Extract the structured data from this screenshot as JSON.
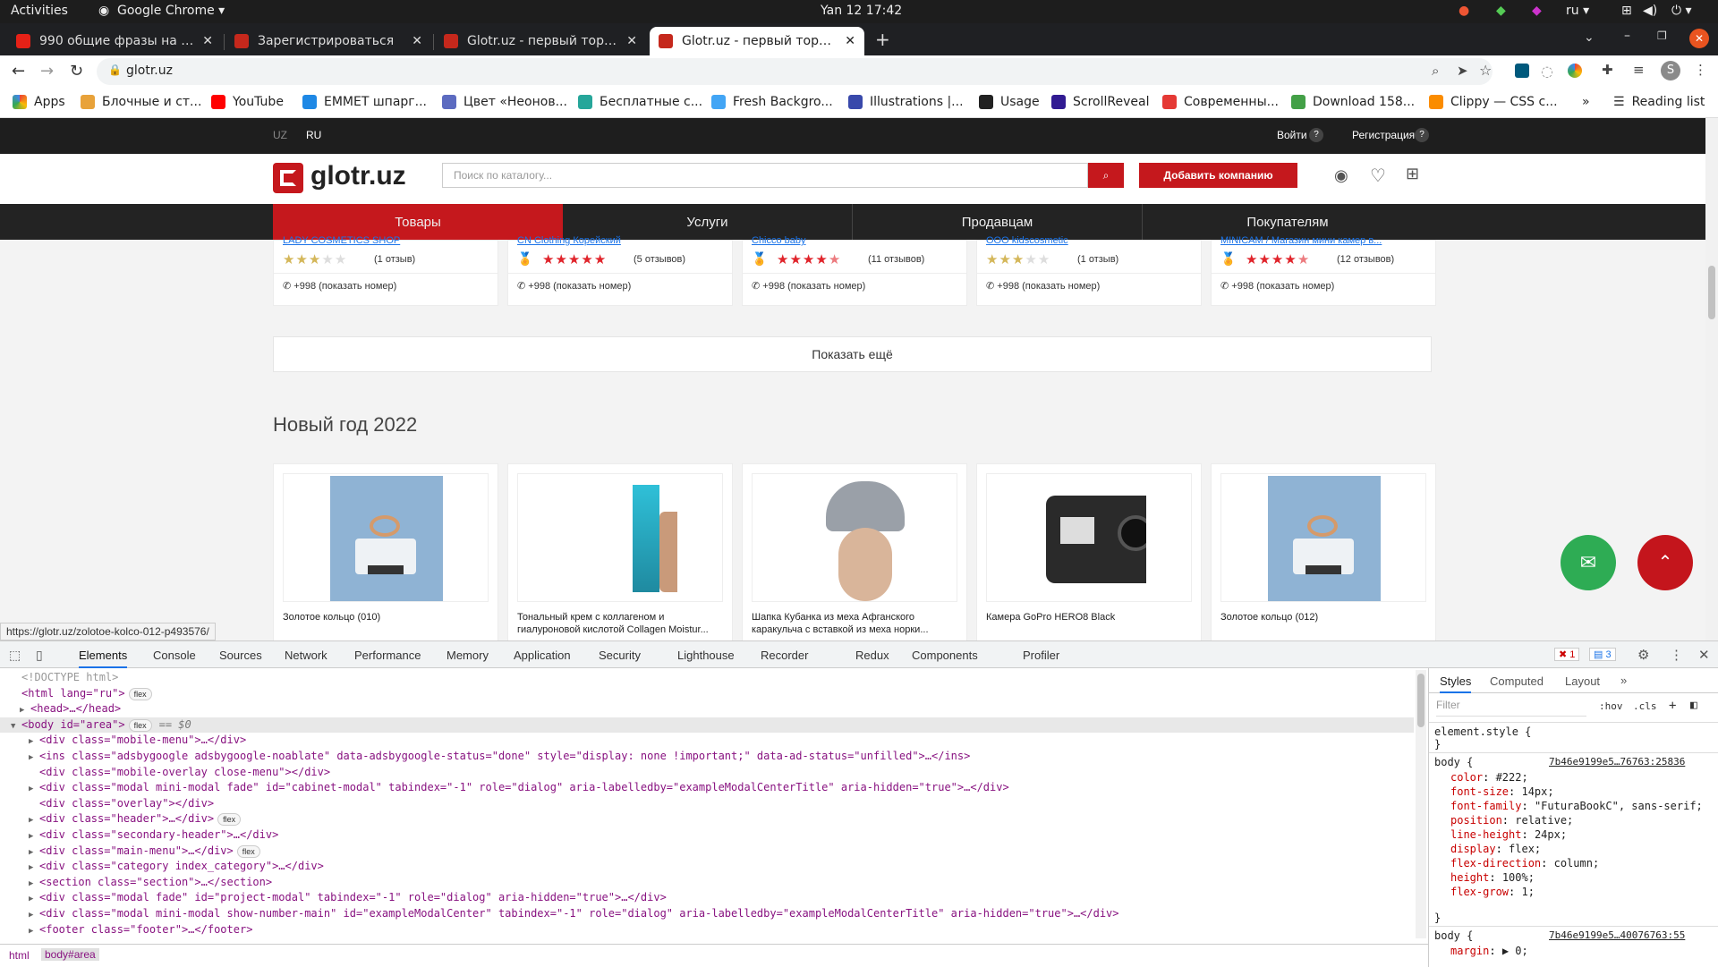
{
  "os": {
    "activities": "Activities",
    "app": "Google Chrome",
    "clock": "Yan 12  17:42",
    "lang": "ru"
  },
  "tabs": [
    {
      "label": "990 общие фразы на англ",
      "color": "#e62117"
    },
    {
      "label": "Зарегистрироваться",
      "color": "#c5281c"
    },
    {
      "label": "Glotr.uz - первый торговый",
      "color": "#c5281c"
    },
    {
      "label": "Glotr.uz - первый торговый",
      "color": "#c5281c"
    }
  ],
  "address": {
    "url": "glotr.uz"
  },
  "bookmarks": [
    {
      "label": "Apps",
      "color": "#ea4335"
    },
    {
      "label": "Блочные и ст...",
      "color": "#e8a23a"
    },
    {
      "label": "YouTube",
      "color": "#ff0000"
    },
    {
      "label": "EMMET шпарг...",
      "color": "#1e88e5"
    },
    {
      "label": "Цвет «Неонов...",
      "color": "#5c6bc0"
    },
    {
      "label": "Бесплатные с...",
      "color": "#26a69a"
    },
    {
      "label": "Fresh Backgro...",
      "color": "#42a5f5"
    },
    {
      "label": "Illustrations |...",
      "color": "#3949ab"
    },
    {
      "label": "Usage",
      "color": "#222222"
    },
    {
      "label": "ScrollReveal",
      "color": "#311b92"
    },
    {
      "label": "Современны...",
      "color": "#e53935"
    },
    {
      "label": "Download 158...",
      "color": "#43a047"
    },
    {
      "label": "Clippy — CSS c...",
      "color": "#fb8c00"
    }
  ],
  "reading_list": "Reading list",
  "site": {
    "lang_uz": "UZ",
    "lang_ru": "RU",
    "login": "Войти",
    "register": "Регистрация",
    "help": "?",
    "logo": "glotr.uz",
    "search_placeholder": "Поиск по каталогу...",
    "add_company": "Добавить компанию",
    "menu": [
      "Товары",
      "Услуги",
      "Продавцам",
      "Покупателям"
    ],
    "sellers": [
      {
        "name": "LADY COSMETICS SHOP",
        "rating": 3,
        "reviews": "(1 отзыв)",
        "phone": "+998 (показать номер)",
        "medal": false
      },
      {
        "name": "CN Clothing Корейский",
        "rating": 5,
        "reviews": "(5 отзывов)",
        "phone": "+998 (показать номер)",
        "medal": true
      },
      {
        "name": "Chicco baby",
        "rating": 4.5,
        "reviews": "(11 отзывов)",
        "phone": "+998 (показать номер)",
        "medal": true
      },
      {
        "name": "OOO kidscosmetic",
        "rating": 3,
        "reviews": "(1 отзыв)",
        "phone": "+998 (показать номер)",
        "medal": false
      },
      {
        "name": "MINICAM / Магазин мини камер в...",
        "rating": 4.5,
        "reviews": "(12 отзывов)",
        "phone": "+998 (показать номер)",
        "medal": true
      }
    ],
    "show_more": "Показать ещё",
    "section_title": "Новый год 2022",
    "products": [
      {
        "title": "Золотое кольцо (010)",
        "image": "ring"
      },
      {
        "title": "Тональный крем с коллагеном и гиалуроновой кислотой Collagen Moistur...",
        "image": "cream"
      },
      {
        "title": "Шапка Кубанка из меха Афганского каракульча с вставкой из меха норки...",
        "image": "hat"
      },
      {
        "title": "Камера GoPro HERO8 Black",
        "image": "camera"
      },
      {
        "title": "Золотое кольцо (012)",
        "image": "ring"
      }
    ],
    "status_url": "https://glotr.uz/zolotoe-kolco-012-p493576/"
  },
  "devtools": {
    "tabs": [
      "Elements",
      "Console",
      "Sources",
      "Network",
      "Performance",
      "Memory",
      "Application",
      "Security",
      "Lighthouse",
      "Recorder",
      "Redux",
      "Components",
      "Profiler"
    ],
    "errors": "1",
    "messages": "3",
    "dom": [
      {
        "indent": 0,
        "text": "<!DOCTYPE html>",
        "kind": "doctype"
      },
      {
        "indent": 0,
        "text": "<html lang=\"ru\">",
        "kind": "tag",
        "badge": "flex"
      },
      {
        "indent": 1,
        "text": "<head>…</head>",
        "kind": "tag",
        "arrow": true
      },
      {
        "indent": 0,
        "text": "<body id=\"area\">",
        "kind": "tag",
        "badge": "flex",
        "suffix": "== $0",
        "selected": true,
        "open": true
      },
      {
        "indent": 2,
        "text": "<div class=\"mobile-menu\">…</div>",
        "kind": "tag",
        "arrow": true
      },
      {
        "indent": 2,
        "text": "<ins class=\"adsbygoogle adsbygoogle-noablate\" data-adsbygoogle-status=\"done\" style=\"display: none !important;\" data-ad-status=\"unfilled\">…</ins>",
        "kind": "tag",
        "arrow": true
      },
      {
        "indent": 2,
        "text": "<div class=\"mobile-overlay close-menu\"></div>",
        "kind": "tag"
      },
      {
        "indent": 2,
        "text": "<div class=\"modal mini-modal fade\" id=\"cabinet-modal\" tabindex=\"-1\" role=\"dialog\" aria-labelledby=\"exampleModalCenterTitle\" aria-hidden=\"true\">…</div>",
        "kind": "tag",
        "arrow": true
      },
      {
        "indent": 2,
        "text": "<div class=\"overlay\"></div>",
        "kind": "tag"
      },
      {
        "indent": 2,
        "text": "<div class=\"header\">…</div>",
        "kind": "tag",
        "arrow": true,
        "badge": "flex"
      },
      {
        "indent": 2,
        "text": "<div class=\"secondary-header\">…</div>",
        "kind": "tag",
        "arrow": true
      },
      {
        "indent": 2,
        "text": "<div class=\"main-menu\">…</div>",
        "kind": "tag",
        "arrow": true,
        "badge": "flex"
      },
      {
        "indent": 2,
        "text": "<div class=\"category index_category\">…</div>",
        "kind": "tag",
        "arrow": true
      },
      {
        "indent": 2,
        "text": "<section class=\"section\">…</section>",
        "kind": "tag",
        "arrow": true
      },
      {
        "indent": 2,
        "text": "<div class=\"modal fade\" id=\"project-modal\" tabindex=\"-1\" role=\"dialog\" aria-hidden=\"true\">…</div>",
        "kind": "tag",
        "arrow": true
      },
      {
        "indent": 2,
        "text": "<div class=\"modal mini-modal show-number-main\" id=\"exampleModalCenter\" tabindex=\"-1\" role=\"dialog\" aria-labelledby=\"exampleModalCenterTitle\" aria-hidden=\"true\">…</div>",
        "kind": "tag",
        "arrow": true
      },
      {
        "indent": 2,
        "text": "<footer class=\"footer\">…</footer>",
        "kind": "tag",
        "arrow": true
      }
    ],
    "breadcrumb": [
      "html",
      "body#area"
    ],
    "styles": {
      "tabs": [
        "Styles",
        "Computed",
        "Layout"
      ],
      "filter": "Filter",
      "hov": ":hov",
      "cls": ".cls",
      "element_style": "element.style {",
      "close": "}",
      "rule1_selector": "body {",
      "rule1_source": "7b46e9199e5…76763:25836",
      "rule1_props": [
        [
          "color",
          "#222;"
        ],
        [
          "font-size",
          "14px;"
        ],
        [
          "font-family",
          "\"FuturaBookC\", sans-serif;"
        ],
        [
          "position",
          "relative;"
        ],
        [
          "line-height",
          "24px;"
        ],
        [
          "display",
          "flex;"
        ],
        [
          "flex-direction",
          "column;"
        ],
        [
          "height",
          "100%;"
        ],
        [
          "flex-grow",
          "1;"
        ]
      ],
      "rule2_selector": "body {",
      "rule2_source": "7b46e9199e5…40076763:55",
      "rule2_props": [
        [
          "margin",
          "▶ 0;"
        ]
      ]
    }
  },
  "colors": {
    "brand_red": "#c5181d",
    "dark": "#232323",
    "green_fab": "#2eac54",
    "red_fab": "#c4151c",
    "star": "#e0242b",
    "star_gold": "#d4b75a"
  }
}
